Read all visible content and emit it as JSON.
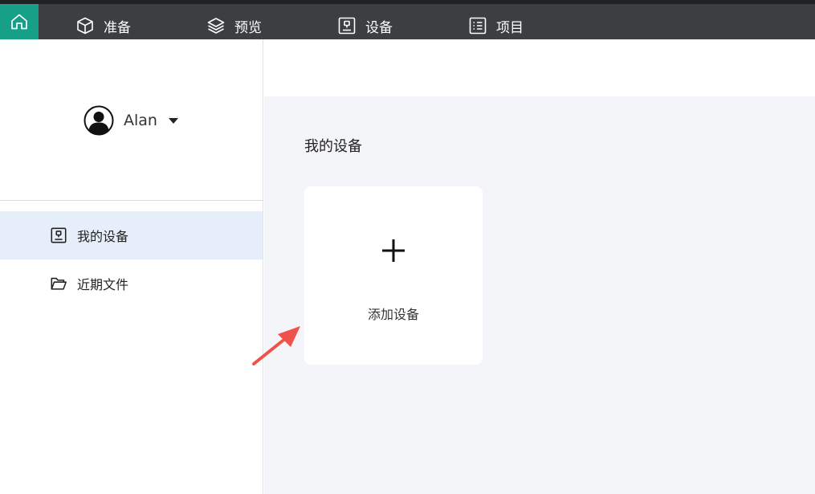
{
  "nav": {
    "home_icon": "home-icon",
    "items": [
      {
        "label": "准备",
        "icon": "cube-icon"
      },
      {
        "label": "预览",
        "icon": "layers-icon"
      },
      {
        "label": "设备",
        "icon": "device-icon"
      },
      {
        "label": "项目",
        "icon": "list-icon"
      }
    ]
  },
  "user": {
    "name": "Alan",
    "icon": "user-avatar-icon"
  },
  "sidebar": {
    "items": [
      {
        "label": "我的设备",
        "icon": "device-icon",
        "active": true
      },
      {
        "label": "近期文件",
        "icon": "folder-icon",
        "active": false
      }
    ]
  },
  "main": {
    "section_title": "我的设备",
    "add_card": {
      "label": "添加设备",
      "icon": "plus-icon"
    }
  },
  "colors": {
    "nav_bg": "#3b3f41",
    "home_accent": "#17a088",
    "sidebar_active": "#e6eff9",
    "content_bg": "#f4f5f9",
    "annotation_arrow": "#f0514b"
  }
}
